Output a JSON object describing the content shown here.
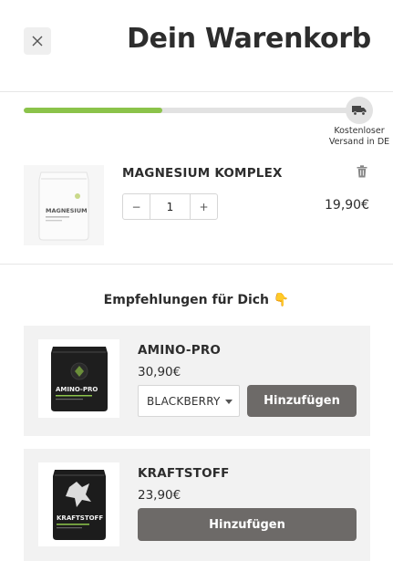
{
  "header": {
    "title": "Dein Warenkorb",
    "close_icon": "close-icon"
  },
  "shipping": {
    "progress_fraction": 0.41,
    "label": "Kostenloser Versand in DE",
    "icon": "truck-icon",
    "fill_color": "#8bc34a"
  },
  "cart": {
    "items": [
      {
        "name": "MAGNESIUM KOMPLEX",
        "quantity": "1",
        "minus": "−",
        "plus": "+",
        "price": "19,90€",
        "pack_label": "MAGNESIUM",
        "remove_icon": "trash-icon"
      }
    ]
  },
  "recommendations": {
    "heading": "Empfehlungen für Dich 👇",
    "items": [
      {
        "name": "AMINO-PRO",
        "price": "30,90€",
        "variant": "BLACKBERRY",
        "add_label": "Hinzufügen",
        "pack_label": "AMINO-PRO"
      },
      {
        "name": "KRAFTSTOFF",
        "price": "23,90€",
        "add_label": "Hinzufügen",
        "pack_label": "KRAFTSTOFF"
      }
    ]
  },
  "colors": {
    "accent_green": "#8bc34a",
    "button_gray": "#6d6a68",
    "card_bg": "#f2f2f2"
  }
}
